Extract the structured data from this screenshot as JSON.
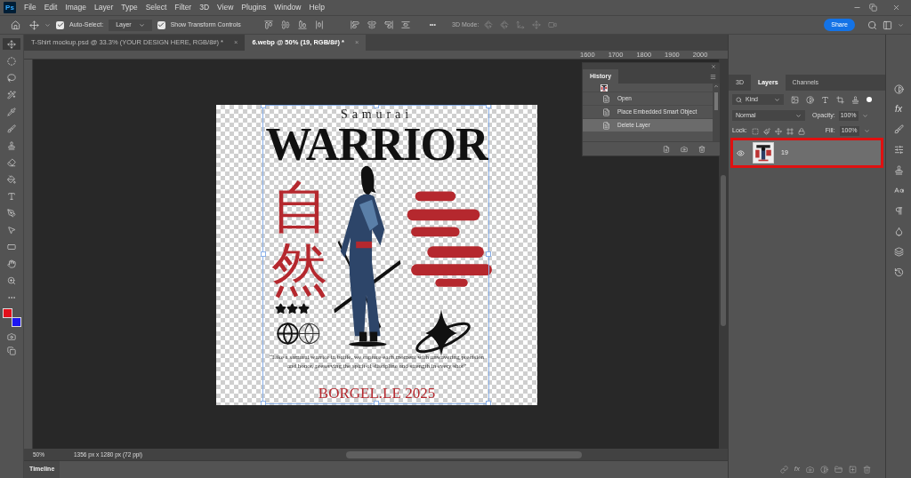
{
  "app_logo": "Ps",
  "menu": [
    "File",
    "Edit",
    "Image",
    "Layer",
    "Type",
    "Select",
    "Filter",
    "3D",
    "View",
    "Plugins",
    "Window",
    "Help"
  ],
  "options_bar": {
    "auto_select": {
      "label": "Auto-Select:",
      "checked": true
    },
    "auto_select_target": "Layer",
    "transform_controls": {
      "label": "Show Transform Controls",
      "checked": true
    },
    "more": "•••",
    "mode_label": "3D Mode:",
    "share": "Share"
  },
  "document_tabs": [
    {
      "title": "T-Shirt mockup.psd @ 33.3% (YOUR DESIGN HERE, RGB/8#) *",
      "close": "×",
      "selected": false
    },
    {
      "title": "6.webp @ 50% (19, RGB/8#) *",
      "close": "×",
      "selected": true
    }
  ],
  "tools": [
    {
      "kind": "move",
      "selected": true
    },
    {
      "kind": "marquee",
      "selected": false
    },
    {
      "kind": "lasso",
      "selected": false
    },
    {
      "kind": "wand",
      "selected": false
    },
    {
      "kind": "eyedropper",
      "selected": false
    },
    {
      "kind": "brush",
      "selected": false
    },
    {
      "kind": "stamp",
      "selected": false
    },
    {
      "kind": "eraser",
      "selected": false
    },
    {
      "kind": "bucket",
      "selected": false
    },
    {
      "kind": "type",
      "selected": false
    },
    {
      "kind": "pen",
      "selected": false
    },
    {
      "kind": "pointer",
      "selected": false
    },
    {
      "kind": "rectangle",
      "selected": false
    },
    {
      "kind": "hand",
      "selected": false
    },
    {
      "kind": "zoom",
      "selected": false
    },
    {
      "kind": "more",
      "selected": false
    }
  ],
  "swatches": [
    {
      "kind": "foreground",
      "color": "#e3101b"
    },
    {
      "kind": "background",
      "color": "#1c16f2"
    }
  ],
  "ruler_labels": [
    "1600",
    "1700",
    "1800",
    "1900",
    "2000"
  ],
  "design": {
    "subtitle": "Samurai",
    "title": "WARRIOR",
    "kanji": "自然",
    "quote": "“Like a samurai warrior in battle, we capture each moment with unwavering precision and honor, preserving the spirit of discipline and strength in every shot”",
    "signature": "BORGEL.LE 2025"
  },
  "history": {
    "title": "History",
    "items": [
      {
        "kind": "snapshot",
        "selected": false
      },
      {
        "kind": "step",
        "label": "Open",
        "selected": false
      },
      {
        "kind": "step",
        "label": "Place Embedded Smart Object",
        "selected": false
      },
      {
        "kind": "step",
        "label": "Delete Layer",
        "selected": true
      }
    ]
  },
  "layers_panel": {
    "tabs": [
      {
        "label": "3D",
        "selected": false
      },
      {
        "label": "Layers",
        "selected": true
      },
      {
        "label": "Channels",
        "selected": false
      }
    ],
    "footer_fx": "fx",
    "filter": "Kind",
    "blend_mode": "Normal",
    "opacity_label": "Opacity:",
    "opacity": "100%",
    "lock_label": "Lock:",
    "fill_label": "Fill:",
    "fill": "100%",
    "layers": [
      {
        "name": "19",
        "visible": true,
        "selected": true,
        "highlighted": true
      }
    ]
  },
  "status_bar": {
    "zoom": "50%",
    "dimensions": "1356 px x 1280 px (72 ppi)"
  },
  "timeline": "Timeline",
  "icon_strip": {
    "fx": "fx"
  }
}
